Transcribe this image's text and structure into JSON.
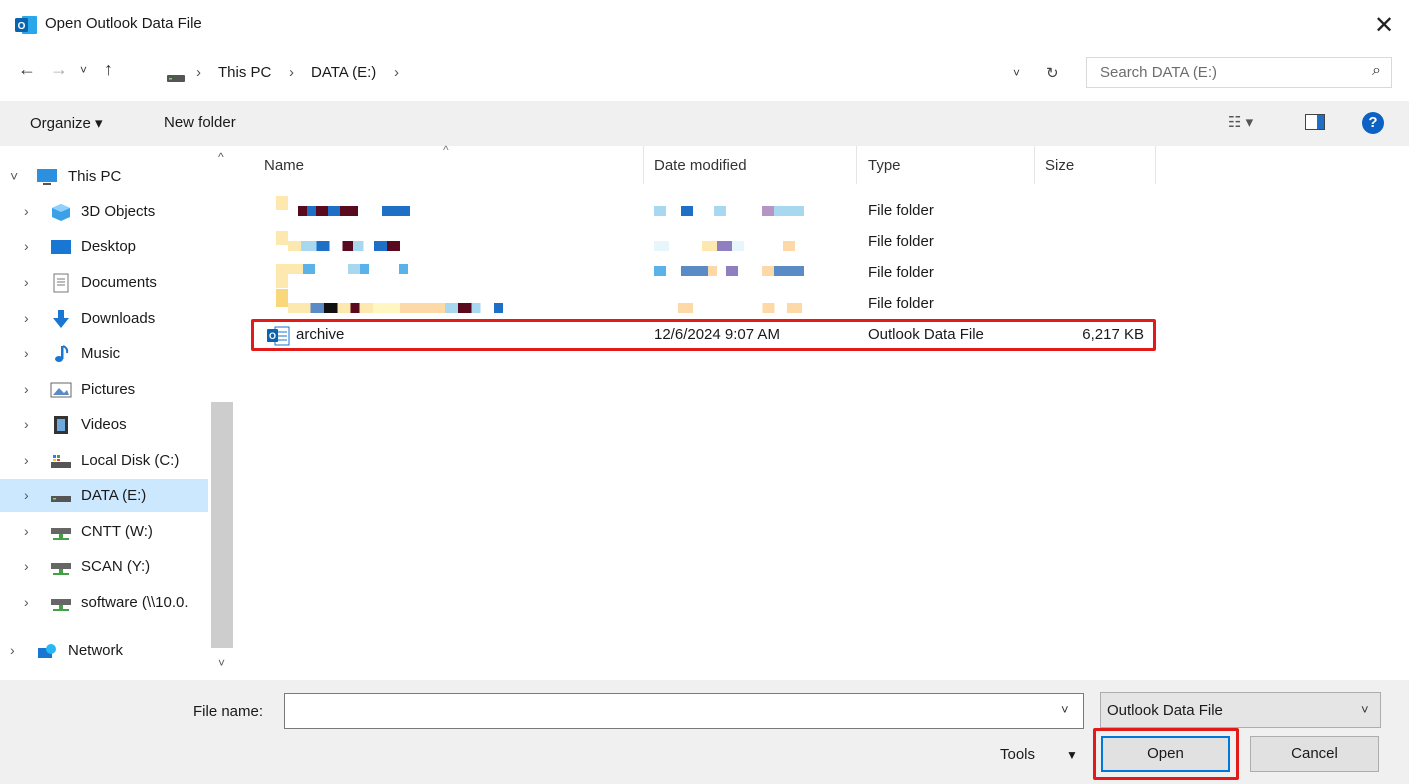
{
  "window": {
    "title": "Open Outlook Data File"
  },
  "nav": {
    "back": "←",
    "forward": "→",
    "recent": "˅",
    "up": "↑",
    "breadcrumbs": [
      "This PC",
      "DATA (E:)"
    ],
    "refresh": "↻",
    "search_placeholder": "Search DATA (E:)"
  },
  "toolbar": {
    "organize": "Organize ▾",
    "new_folder": "New folder",
    "help": "?"
  },
  "sidebar": {
    "items": [
      {
        "label": "This PC",
        "icon": "monitor-icon"
      },
      {
        "label": "3D Objects",
        "icon": "cube-icon"
      },
      {
        "label": "Desktop",
        "icon": "desktop-icon"
      },
      {
        "label": "Documents",
        "icon": "document-icon"
      },
      {
        "label": "Downloads",
        "icon": "download-icon"
      },
      {
        "label": "Music",
        "icon": "music-icon"
      },
      {
        "label": "Pictures",
        "icon": "pictures-icon"
      },
      {
        "label": "Videos",
        "icon": "videos-icon"
      },
      {
        "label": "Local Disk (C:)",
        "icon": "local-disk-icon"
      },
      {
        "label": "DATA (E:)",
        "icon": "drive-icon"
      },
      {
        "label": "CNTT (W:)",
        "icon": "network-drive-icon"
      },
      {
        "label": "SCAN (Y:)",
        "icon": "network-drive-icon"
      },
      {
        "label": "software (\\\\10.0.",
        "icon": "network-drive-icon"
      },
      {
        "label": "Network",
        "icon": "network-icon"
      }
    ]
  },
  "columns": {
    "name": "Name",
    "date": "Date modified",
    "type": "Type",
    "size": "Size"
  },
  "files": [
    {
      "type": "File folder"
    },
    {
      "type": "File folder"
    },
    {
      "type": "File folder"
    },
    {
      "type": "File folder"
    },
    {
      "name": "archive",
      "date": "12/6/2024 9:07 AM",
      "type": "Outlook Data File",
      "size": "6,217 KB"
    }
  ],
  "bottom": {
    "file_name_label": "File name:",
    "file_name_value": "",
    "filter": "Outlook Data File",
    "tools": "Tools",
    "open": "Open",
    "cancel": "Cancel"
  },
  "colors": {
    "accent": "#0078d7",
    "highlight": "#e21a1a",
    "selected": "#cce8ff"
  }
}
